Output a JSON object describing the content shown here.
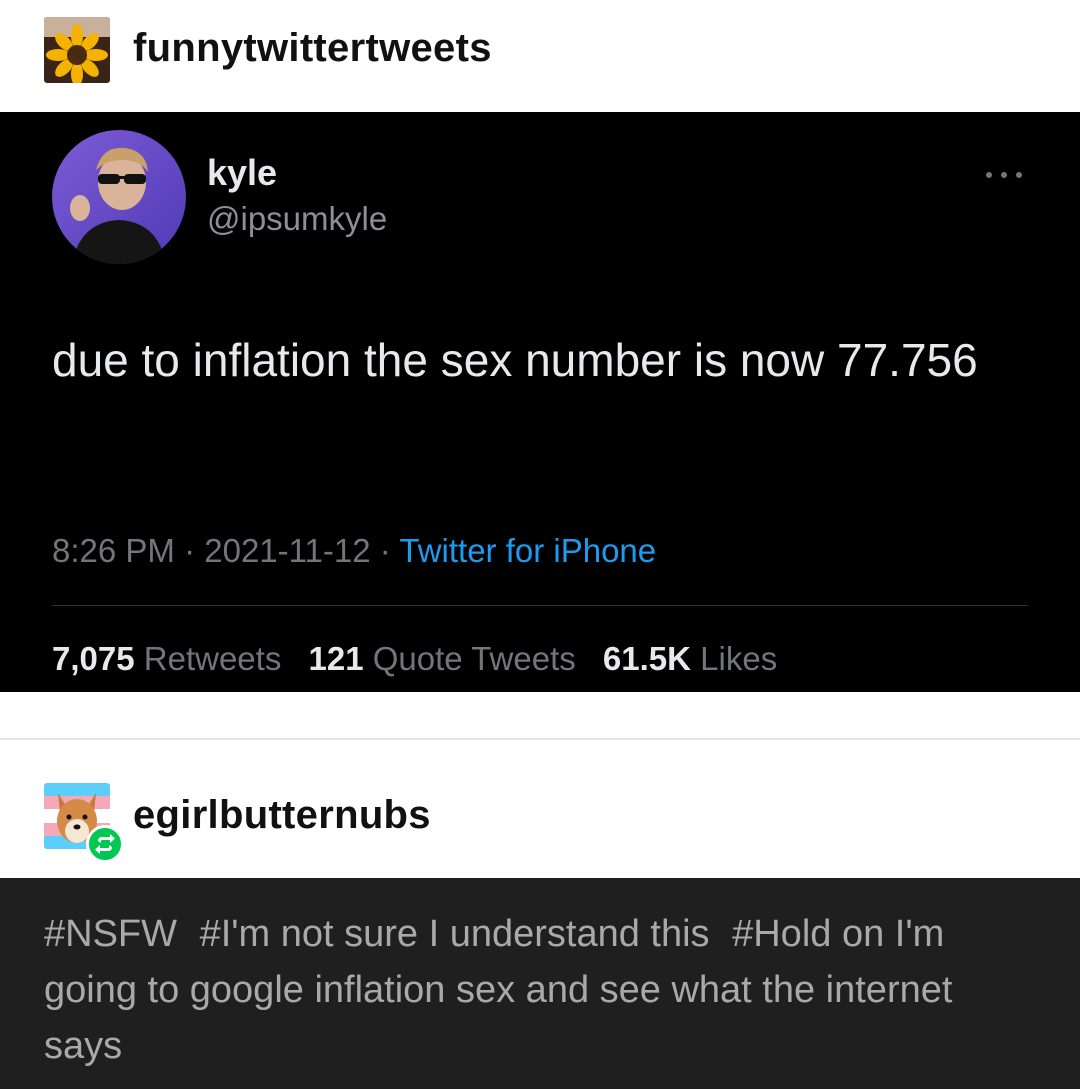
{
  "post": {
    "blog_name": "funnytwittertweets",
    "avatar_icon": "sunflower-avatar-icon"
  },
  "tweet": {
    "display_name": "kyle",
    "handle": "@ipsumkyle",
    "text": "due to inflation the sex number is now 77.756",
    "time": "8:26 PM",
    "separator": "·",
    "date": "2021-11-12",
    "source": "Twitter for iPhone",
    "retweets_count": "7,075",
    "retweets_label": "Retweets",
    "quote_count": "121",
    "quote_label": "Quote Tweets",
    "likes_count": "61.5K",
    "likes_label": "Likes",
    "colors": {
      "background": "#000000",
      "link": "#1d9bf0",
      "muted": "#71767b"
    }
  },
  "reblog": {
    "blog_name": "egirlbutternubs",
    "avatar_icon": "shiba-dog-avatar-icon",
    "badge_icon": "reblog-icon",
    "badge_color": "#00c853"
  },
  "tags": [
    "#NSFW",
    "#I'm not sure I understand this",
    "#Hold on I'm going to google inflation sex and see what the internet says"
  ]
}
